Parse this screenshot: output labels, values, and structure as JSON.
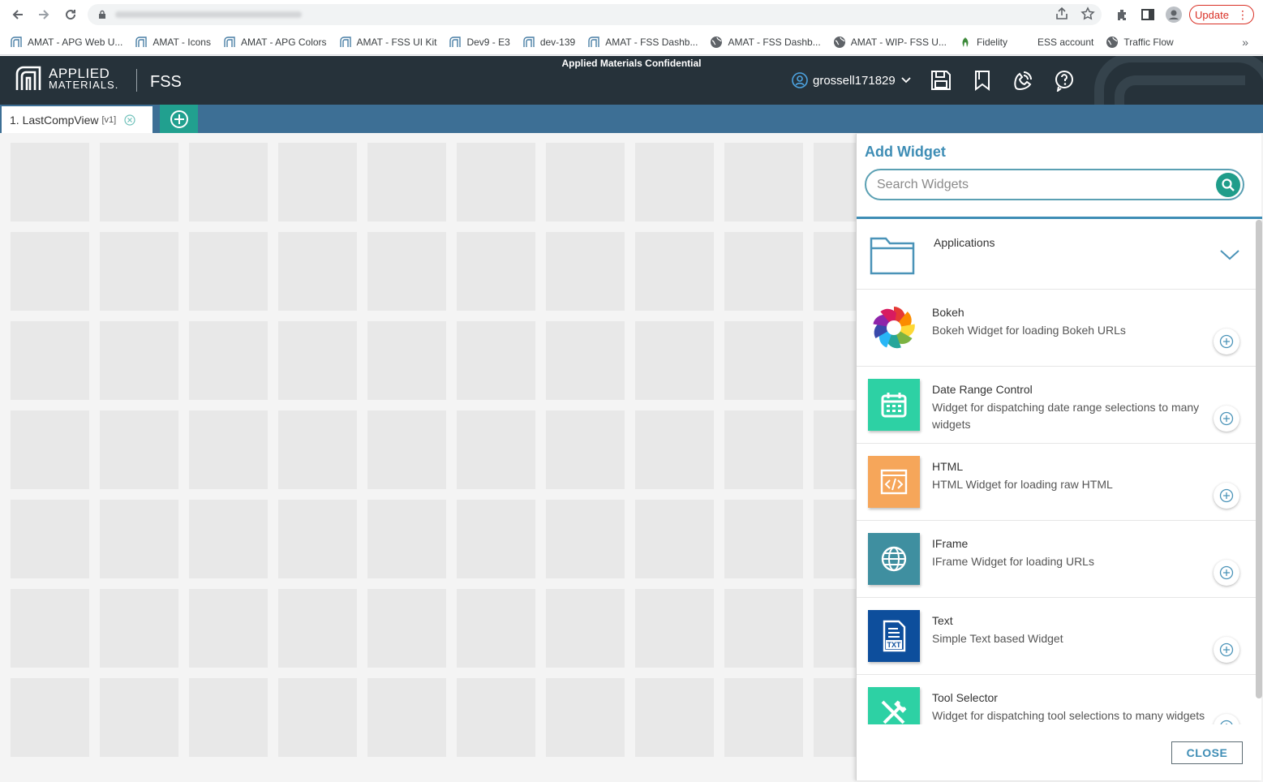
{
  "browser": {
    "bookmarks": [
      {
        "label": "AMAT - APG Web U...",
        "icon": "amat-logo-icon"
      },
      {
        "label": "AMAT - Icons",
        "icon": "amat-logo-icon"
      },
      {
        "label": "AMAT - APG Colors",
        "icon": "amat-logo-icon"
      },
      {
        "label": "AMAT - FSS UI Kit",
        "icon": "amat-logo-icon"
      },
      {
        "label": "Dev9 - E3",
        "icon": "amat-logo-icon"
      },
      {
        "label": "dev-139",
        "icon": "amat-logo-icon"
      },
      {
        "label": "AMAT - FSS Dashb...",
        "icon": "amat-logo-icon"
      },
      {
        "label": "AMAT - FSS Dashb...",
        "icon": "globe-icon"
      },
      {
        "label": "AMAT - WIP- FSS U...",
        "icon": "globe-icon"
      },
      {
        "label": "Fidelity",
        "icon": "fidelity-icon"
      },
      {
        "label": "ESS account",
        "icon": ""
      },
      {
        "label": "Traffic Flow",
        "icon": "globe-icon"
      }
    ],
    "bookmarks_more": "»",
    "update_label": "Update"
  },
  "header": {
    "logo_line1": "APPLIED",
    "logo_line2": "MATERIALS.",
    "app_name": "FSS",
    "confidential": "Applied Materials Confidential",
    "username": "grossell171829"
  },
  "tabs": [
    {
      "label": "1. LastCompView",
      "version": "[v1]"
    }
  ],
  "panel": {
    "title": "Add Widget",
    "search_placeholder": "Search Widgets",
    "category": "Applications",
    "widgets": [
      {
        "name": "Bokeh",
        "description": "Bokeh Widget for loading Bokeh URLs",
        "icon": "bokeh-icon",
        "color": "#ffffff"
      },
      {
        "name": "Date Range Control",
        "description": "Widget for dispatching date range selections to many widgets",
        "icon": "calendar-icon",
        "color": "#2dd1a4"
      },
      {
        "name": "HTML",
        "description": "HTML Widget for loading raw HTML",
        "icon": "code-window-icon",
        "color": "#f6a65a"
      },
      {
        "name": "IFrame",
        "description": "IFrame Widget for loading URLs",
        "icon": "globe-icon",
        "color": "#3f8fa0"
      },
      {
        "name": "Text",
        "description": "Simple Text based Widget",
        "icon": "txt-file-icon",
        "color": "#0d4e9c"
      },
      {
        "name": "Tool Selector",
        "description": "Widget for dispatching tool selections to many widgets",
        "icon": "tools-icon",
        "color": "#2dd1a4"
      }
    ],
    "close_label": "CLOSE"
  },
  "colors": {
    "header_bg": "#26323a",
    "tab_strip": "#3d6f95",
    "accent_teal": "#21a08f",
    "title_blue": "#3e8db5"
  }
}
